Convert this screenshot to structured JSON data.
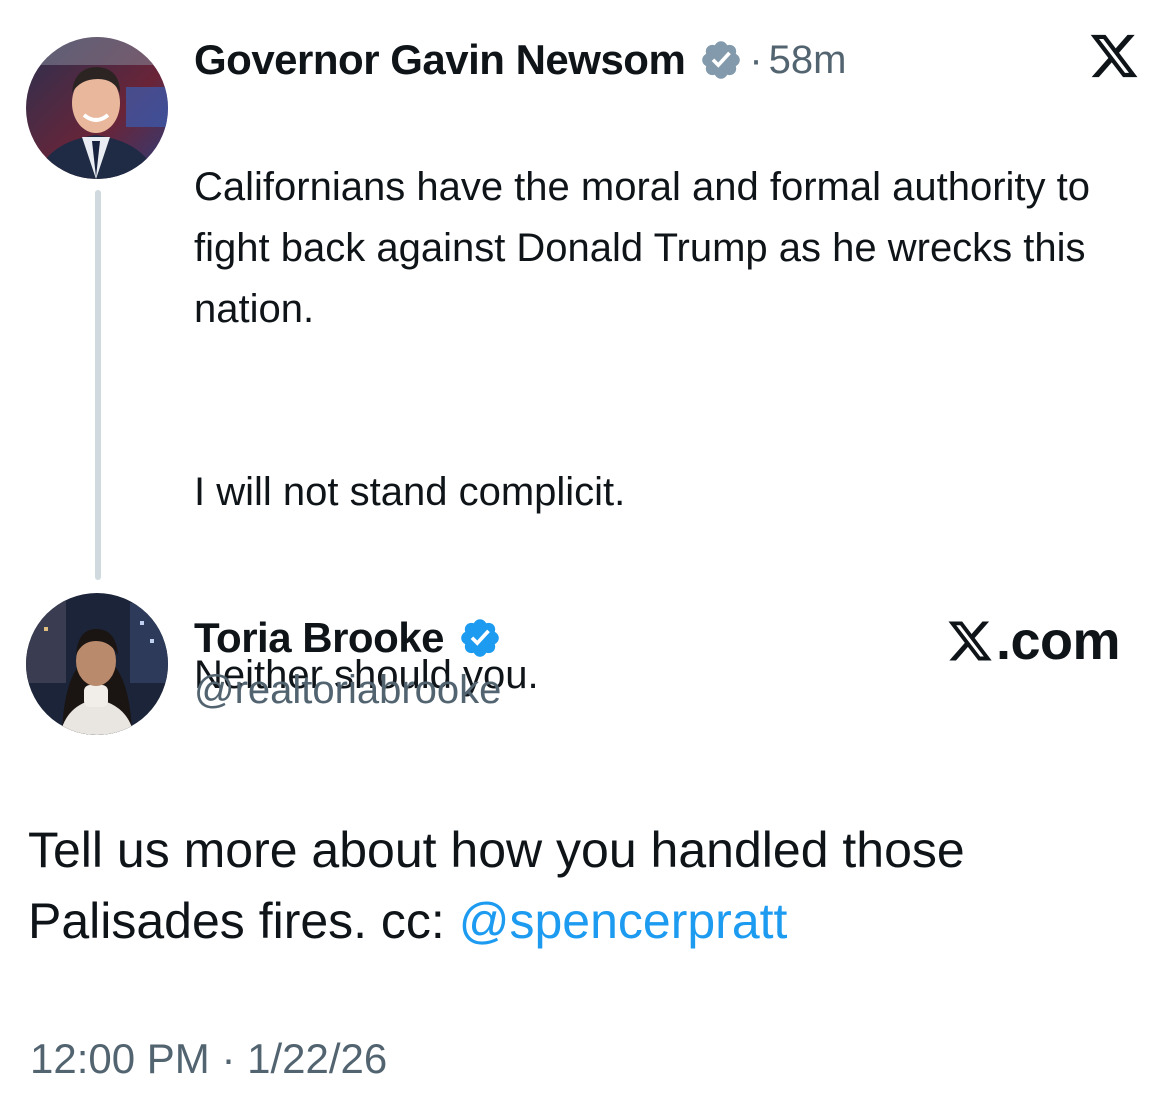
{
  "quoted_post": {
    "author_name": "Governor Gavin Newsom",
    "separator": "·",
    "time_ago": "58m",
    "text_para_1": "Californians have the moral and formal authority to fight back against Donald Trump as he wrecks this nation.",
    "text_para_2": "I will not stand complicit.",
    "text_para_3": "Neither should you.",
    "verified_badge_color": "#829aab",
    "brand_logo": "x-logo"
  },
  "reply_post": {
    "author_name": "Toria Brooke",
    "handle": "@realtoriabrooke",
    "verified_badge_color": "#1d9bf0",
    "source_label": ".com",
    "text_before_mention": "Tell us more about how you handled those Palisades fires. cc: ",
    "mention": "@spencerpratt",
    "mention_color": "#1d9bf0",
    "timestamp": "12:00 PM · 1/22/26"
  }
}
